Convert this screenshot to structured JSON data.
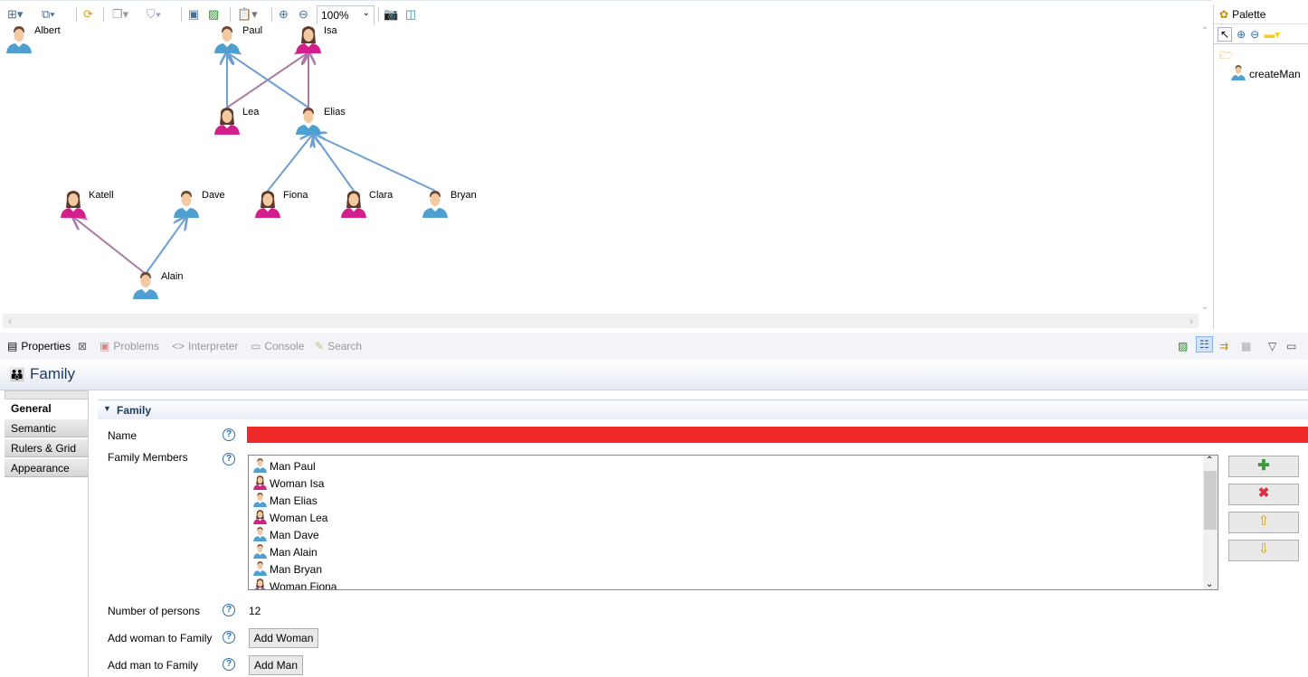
{
  "toolbar": {
    "zoom_value": "100%"
  },
  "palette": {
    "title": "Palette",
    "tool_create_man": "createMan"
  },
  "diagram": {
    "nodes": [
      {
        "name": "Albert",
        "gender": "man"
      },
      {
        "name": "Paul",
        "gender": "man"
      },
      {
        "name": "Isa",
        "gender": "woman"
      },
      {
        "name": "Lea",
        "gender": "woman"
      },
      {
        "name": "Elias",
        "gender": "man"
      },
      {
        "name": "Katell",
        "gender": "woman"
      },
      {
        "name": "Dave",
        "gender": "man"
      },
      {
        "name": "Fiona",
        "gender": "woman"
      },
      {
        "name": "Clara",
        "gender": "woman"
      },
      {
        "name": "Bryan",
        "gender": "man"
      },
      {
        "name": "Alain",
        "gender": "man"
      }
    ],
    "edges": [
      {
        "from": "Lea",
        "to": "Paul",
        "type": "father"
      },
      {
        "from": "Lea",
        "to": "Isa",
        "type": "mother"
      },
      {
        "from": "Elias",
        "to": "Paul",
        "type": "father"
      },
      {
        "from": "Elias",
        "to": "Isa",
        "type": "mother"
      },
      {
        "from": "Fiona",
        "to": "Elias",
        "type": "father"
      },
      {
        "from": "Clara",
        "to": "Elias",
        "type": "father"
      },
      {
        "from": "Bryan",
        "to": "Elias",
        "type": "father"
      },
      {
        "from": "Alain",
        "to": "Katell",
        "type": "mother"
      },
      {
        "from": "Alain",
        "to": "Dave",
        "type": "father"
      }
    ],
    "colors": {
      "man": "#4f9fd0",
      "woman": "#d21f8c",
      "father_edge": "#6e9fd2",
      "mother_edge": "#a97aa8"
    }
  },
  "views": {
    "tabs": [
      {
        "label": "Properties"
      },
      {
        "label": "Problems"
      },
      {
        "label": "Interpreter"
      },
      {
        "label": "Console"
      },
      {
        "label": "Search"
      }
    ]
  },
  "properties": {
    "title": "Family",
    "side_tabs": [
      "General",
      "Semantic",
      "Rulers & Grid",
      "Appearance"
    ],
    "section_title": "Family",
    "name_label": "Name",
    "name_value": "",
    "name_error_color": "#f0292b",
    "members_label": "Family Members",
    "members": [
      {
        "text": "Man Paul",
        "gender": "man"
      },
      {
        "text": "Woman Isa",
        "gender": "woman"
      },
      {
        "text": "Man Elias",
        "gender": "man"
      },
      {
        "text": "Woman Lea",
        "gender": "woman"
      },
      {
        "text": "Man Dave",
        "gender": "man"
      },
      {
        "text": "Man Alain",
        "gender": "man"
      },
      {
        "text": "Man Bryan",
        "gender": "man"
      },
      {
        "text": "Woman Fiona",
        "gender": "woman"
      }
    ],
    "count_label": "Number of persons",
    "count_value": "12",
    "add_woman_label": "Add woman to Family",
    "add_woman_button": "Add Woman",
    "add_man_label": "Add man to Family",
    "add_man_button": "Add Man"
  }
}
